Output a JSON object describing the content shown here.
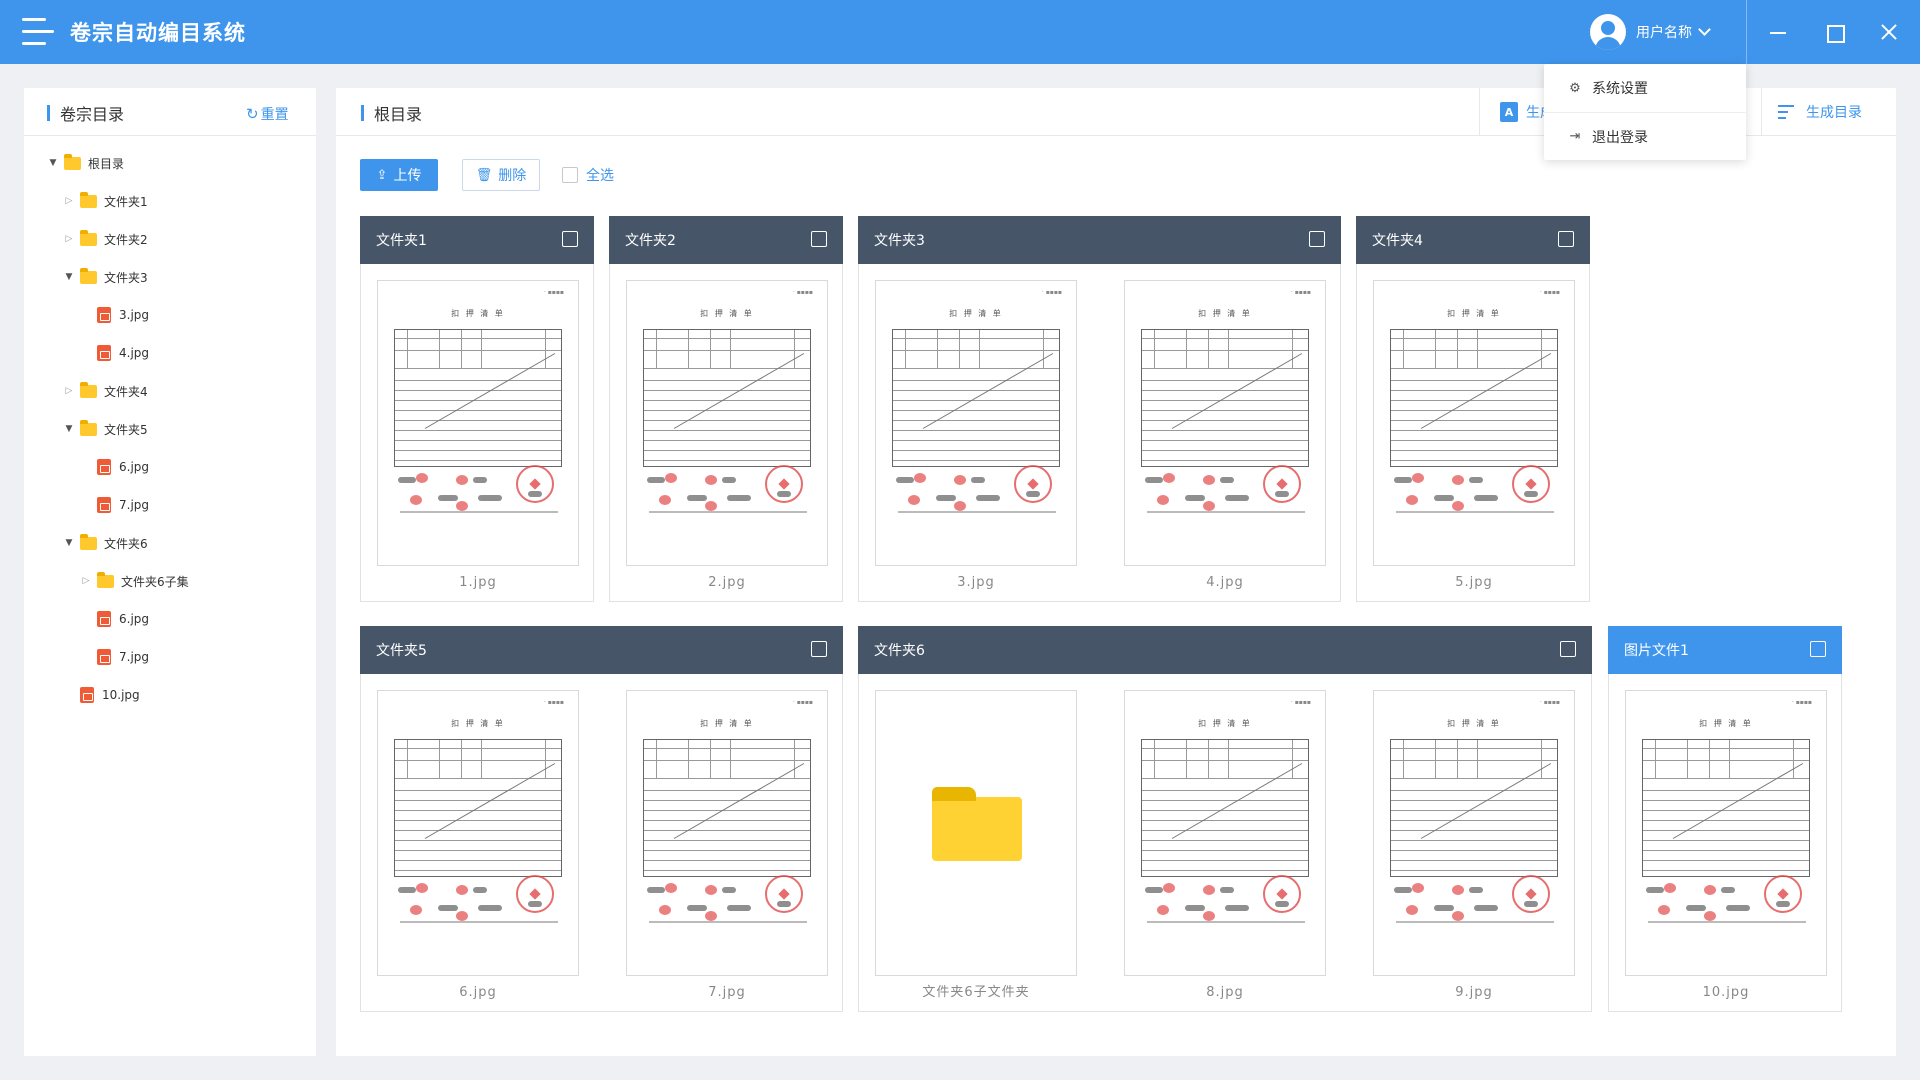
{
  "app": {
    "title": "卷宗自动编目系统"
  },
  "header": {
    "user_name": "用户名称"
  },
  "user_menu": {
    "items": [
      {
        "label": "系统设置",
        "icon": "gear-icon"
      },
      {
        "label": "退出登录",
        "icon": "logout-icon"
      }
    ]
  },
  "left_panel": {
    "title": "卷宗目录",
    "reset_label": "重置",
    "tree": [
      {
        "label": "根目录",
        "type": "folder",
        "depth": 0,
        "expanded": true
      },
      {
        "label": "文件夹1",
        "type": "folder",
        "depth": 1,
        "expanded": false
      },
      {
        "label": "文件夹2",
        "type": "folder",
        "depth": 1,
        "expanded": false
      },
      {
        "label": "文件夹3",
        "type": "folder",
        "depth": 1,
        "expanded": true
      },
      {
        "label": "3.jpg",
        "type": "image",
        "depth": 2
      },
      {
        "label": "4.jpg",
        "type": "image",
        "depth": 2
      },
      {
        "label": "文件夹4",
        "type": "folder",
        "depth": 1,
        "expanded": false
      },
      {
        "label": "文件夹5",
        "type": "folder",
        "depth": 1,
        "expanded": true
      },
      {
        "label": "6.jpg",
        "type": "image",
        "depth": 2
      },
      {
        "label": "7.jpg",
        "type": "image",
        "depth": 2
      },
      {
        "label": "文件夹6",
        "type": "folder",
        "depth": 1,
        "expanded": true
      },
      {
        "label": "文件夹6子集",
        "type": "folder",
        "depth": 2,
        "expanded": false
      },
      {
        "label": "6.jpg",
        "type": "image",
        "depth": 2
      },
      {
        "label": "7.jpg",
        "type": "image",
        "depth": 2
      },
      {
        "label": "10.jpg",
        "type": "image",
        "depth": 1
      }
    ]
  },
  "main": {
    "title": "根目录",
    "generate_pdf_label": "生成PDF",
    "generate_catalog_label": "生成目录",
    "upload_label": "上传",
    "delete_label": "删除",
    "select_all_label": "全选",
    "doc_title": "扣 押 清 单",
    "groups": [
      {
        "title": "文件夹1",
        "items": [
          {
            "label": "1.jpg",
            "kind": "image"
          }
        ]
      },
      {
        "title": "文件夹2",
        "items": [
          {
            "label": "2.jpg",
            "kind": "image"
          }
        ]
      },
      {
        "title": "文件夹3",
        "items": [
          {
            "label": "3.jpg",
            "kind": "image"
          },
          {
            "label": "4.jpg",
            "kind": "image"
          }
        ]
      },
      {
        "title": "文件夹4",
        "items": [
          {
            "label": "5.jpg",
            "kind": "image"
          }
        ]
      },
      {
        "title": "文件夹5",
        "items": [
          {
            "label": "6.jpg",
            "kind": "image"
          },
          {
            "label": "7.jpg",
            "kind": "image"
          }
        ]
      },
      {
        "title": "文件夹6",
        "items": [
          {
            "label": "文件夹6子文件夹",
            "kind": "folder"
          },
          {
            "label": "8.jpg",
            "kind": "image"
          },
          {
            "label": "9.jpg",
            "kind": "image"
          }
        ]
      },
      {
        "title": "图片文件1",
        "selected": true,
        "items": [
          {
            "label": "10.jpg",
            "kind": "image"
          }
        ]
      }
    ]
  },
  "colors": {
    "primary": "#3f95ec",
    "group_header": "#465568",
    "folder": "#ffc82c",
    "image_icon": "#ef5b36"
  }
}
